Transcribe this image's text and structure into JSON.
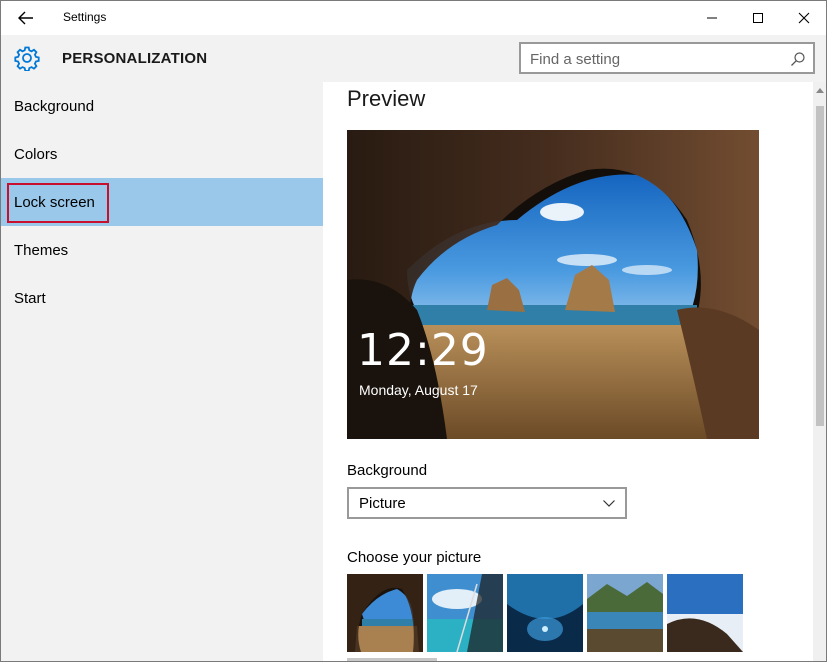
{
  "window": {
    "title": "Settings"
  },
  "header": {
    "section_title": "PERSONALIZATION",
    "search_placeholder": "Find a setting"
  },
  "sidebar": {
    "items": [
      {
        "label": "Background",
        "selected": false
      },
      {
        "label": "Colors",
        "selected": false
      },
      {
        "label": "Lock screen",
        "selected": true
      },
      {
        "label": "Themes",
        "selected": false
      },
      {
        "label": "Start",
        "selected": false
      }
    ]
  },
  "main": {
    "preview_title": "Preview",
    "preview_time": "12:29",
    "preview_date": "Monday, August 17",
    "background_label": "Background",
    "background_value": "Picture",
    "choose_label": "Choose your picture"
  },
  "colors": {
    "accent": "#0078d7",
    "selected_nav": "#9ac8ea",
    "highlight_box": "#c8102e",
    "sidebar_bg": "#f2f2f2"
  },
  "icons": {
    "back": "back-arrow-icon",
    "settings": "gear-icon",
    "search": "search-icon",
    "dropdown": "chevron-down-icon"
  }
}
